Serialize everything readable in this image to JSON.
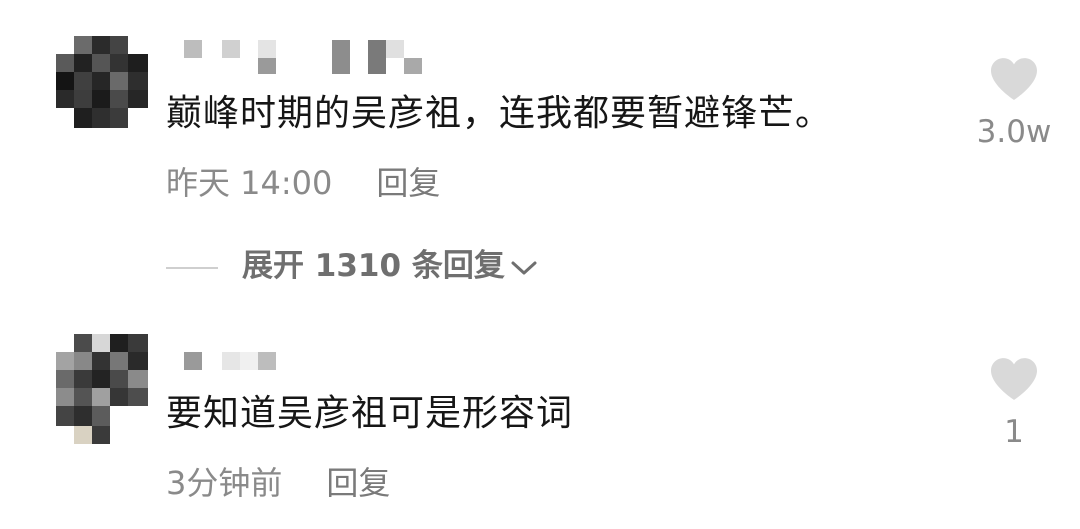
{
  "comments": [
    {
      "text": "巅峰时期的吴彦祖，连我都要暂避锋芒。",
      "time": "昨天 14:00",
      "reply_label": "回复",
      "like_count": "3.0w",
      "expand_label": "展开 1310 条回复"
    },
    {
      "text": "要知道吴彦祖可是形容词",
      "time": "3分钟前",
      "reply_label": "回复",
      "like_count": "1"
    }
  ],
  "icons": {
    "like": "heart-icon",
    "expand": "chevron-down-icon"
  },
  "colors": {
    "text": "#161616",
    "secondary": "#8a8a8a",
    "heart": "#d9d9d9"
  }
}
